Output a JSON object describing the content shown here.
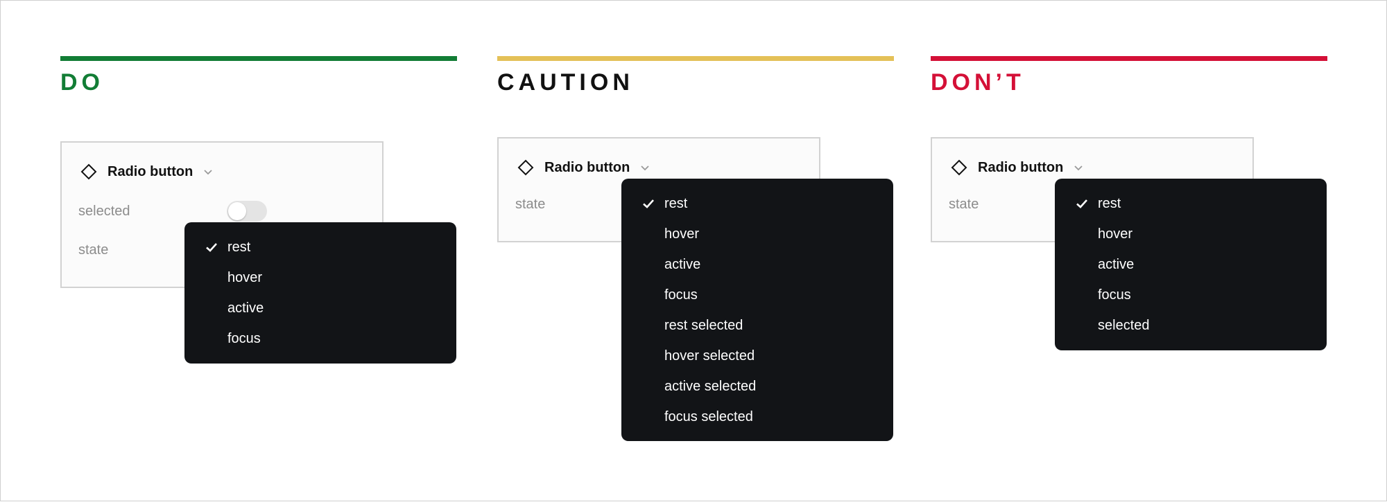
{
  "colors": {
    "do": "#127d35",
    "caution": "#e4c158",
    "dont": "#d41037"
  },
  "columns": [
    {
      "heading": "DO",
      "component": "Radio button",
      "props": {
        "selected": "selected",
        "state": "state"
      },
      "menu": [
        "rest",
        "hover",
        "active",
        "focus"
      ],
      "checked": "rest"
    },
    {
      "heading": "CAUTION",
      "component": "Radio button",
      "props": {
        "state": "state"
      },
      "menu": [
        "rest",
        "hover",
        "active",
        "focus",
        "rest selected",
        "hover selected",
        "active selected",
        "focus selected"
      ],
      "checked": "rest"
    },
    {
      "heading": "DON’T",
      "component": "Radio button",
      "props": {
        "state": "state"
      },
      "menu": [
        "rest",
        "hover",
        "active",
        "focus",
        "selected"
      ],
      "checked": "rest"
    }
  ]
}
